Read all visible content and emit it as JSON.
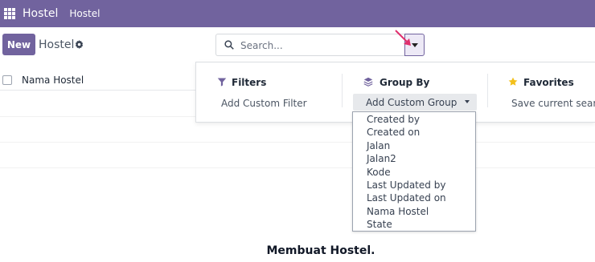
{
  "navbar": {
    "app_name": "Hostel",
    "menu_item": "Hostel"
  },
  "control_panel": {
    "new_label": "New",
    "breadcrumb": "Hostel"
  },
  "search": {
    "placeholder": "Search..."
  },
  "list": {
    "column_header": "Nama Hostel"
  },
  "panel": {
    "filters": {
      "title": "Filters",
      "action": "Add Custom Filter"
    },
    "group_by": {
      "title": "Group By",
      "select_value": "Add Custom Group"
    },
    "favorites": {
      "title": "Favorites",
      "action": "Save current search"
    }
  },
  "group_options": [
    "Created by",
    "Created on",
    "Jalan",
    "Jalan2",
    "Kode",
    "Last Updated by",
    "Last Updated on",
    "Nama Hostel",
    "State"
  ],
  "empty_state": {
    "title": "Membuat Hostel."
  },
  "colors": {
    "brand": "#71639e",
    "annotation_arrow": "#e0306e",
    "favorites_star": "#f3c01b"
  },
  "icons": [
    "apps-icon",
    "gear-icon",
    "search-icon",
    "caret-down-icon",
    "filter-icon",
    "layers-icon",
    "star-icon"
  ]
}
